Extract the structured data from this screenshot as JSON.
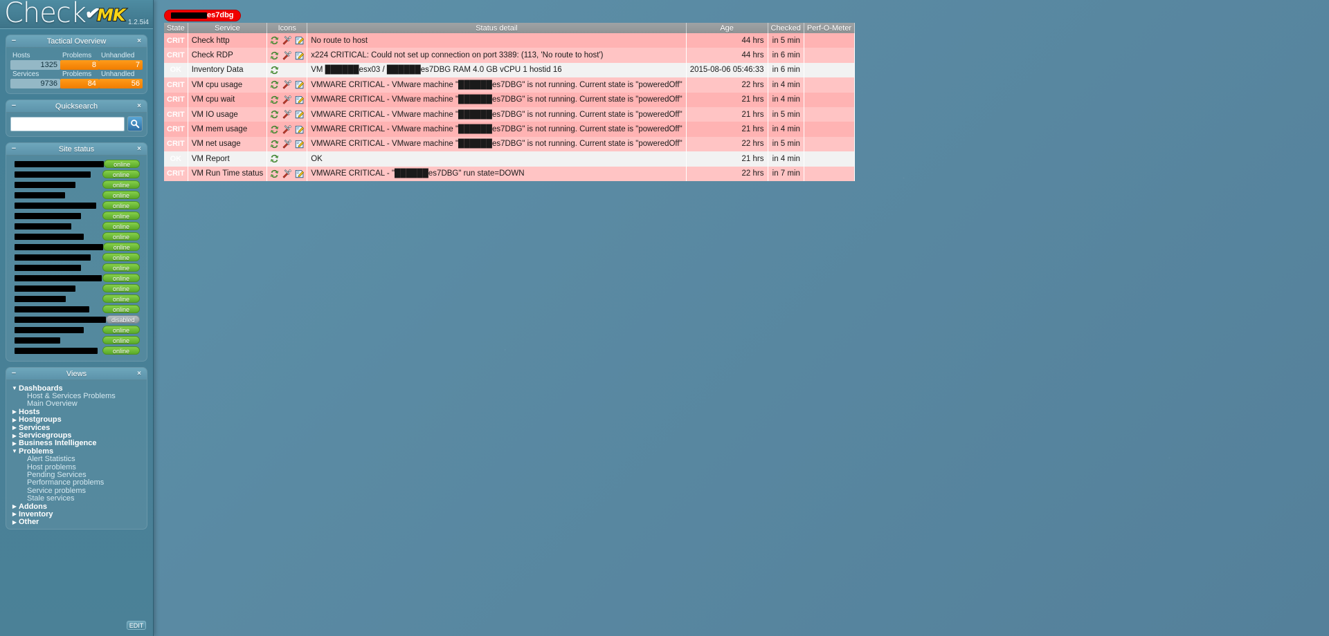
{
  "sidebar": {
    "logo": {
      "text": "Check",
      "mk": "MK",
      "check_glyph": "✔",
      "version": "1.2.5i4"
    },
    "tactical": {
      "title": "Tactical Overview",
      "minus": "−",
      "close": "×",
      "col_headers": [
        "",
        "Problems",
        "Unhandled"
      ],
      "rows": [
        {
          "label": "Hosts",
          "total": "1325",
          "problems": "8",
          "unhandled": "7"
        },
        {
          "label": "Services",
          "total": "9736",
          "problems": "84",
          "unhandled": "56"
        }
      ]
    },
    "quicksearch": {
      "title": "Quicksearch",
      "minus": "−",
      "close": "×",
      "value": "",
      "placeholder": "",
      "search_icon": "search-icon"
    },
    "site_status": {
      "title": "Site status",
      "minus": "−",
      "close": "×",
      "sites": [
        {
          "name_width": 135,
          "status": "online",
          "label": "online"
        },
        {
          "name_width": 110,
          "status": "online",
          "label": "online"
        },
        {
          "name_width": 88,
          "status": "online",
          "label": "online"
        },
        {
          "name_width": 73,
          "status": "online",
          "label": "online"
        },
        {
          "name_width": 118,
          "status": "online",
          "label": "online"
        },
        {
          "name_width": 96,
          "status": "online",
          "label": "online"
        },
        {
          "name_width": 82,
          "status": "online",
          "label": "online"
        },
        {
          "name_width": 100,
          "status": "online",
          "label": "online"
        },
        {
          "name_width": 132,
          "status": "online",
          "label": "online"
        },
        {
          "name_width": 110,
          "status": "online",
          "label": "online"
        },
        {
          "name_width": 96,
          "status": "online",
          "label": "online"
        },
        {
          "name_width": 126,
          "status": "online",
          "label": "online"
        },
        {
          "name_width": 88,
          "status": "online",
          "label": "online"
        },
        {
          "name_width": 74,
          "status": "online",
          "label": "online"
        },
        {
          "name_width": 108,
          "status": "online",
          "label": "online"
        },
        {
          "name_width": 148,
          "status": "disabled",
          "label": "disabled"
        },
        {
          "name_width": 100,
          "status": "online",
          "label": "online"
        },
        {
          "name_width": 66,
          "status": "online",
          "label": "online"
        },
        {
          "name_width": 120,
          "status": "online",
          "label": "online"
        }
      ]
    },
    "views": {
      "title": "Views",
      "minus": "−",
      "close": "×",
      "edit_label": "EDIT",
      "items": [
        {
          "label": "Dashboards",
          "type": "top",
          "expanded": true
        },
        {
          "label": "Host & Services Problems",
          "type": "sub"
        },
        {
          "label": "Main Overview",
          "type": "sub"
        },
        {
          "label": "Hosts",
          "type": "top",
          "expanded": false
        },
        {
          "label": "Hostgroups",
          "type": "top",
          "expanded": false
        },
        {
          "label": "Services",
          "type": "top",
          "expanded": false
        },
        {
          "label": "Servicegroups",
          "type": "top",
          "expanded": false
        },
        {
          "label": "Business Intelligence",
          "type": "top",
          "expanded": false
        },
        {
          "label": "Problems",
          "type": "top",
          "expanded": true
        },
        {
          "label": "Alert Statistics",
          "type": "sub"
        },
        {
          "label": "Host problems",
          "type": "sub"
        },
        {
          "label": "Pending Services",
          "type": "sub"
        },
        {
          "label": "Performance problems",
          "type": "sub"
        },
        {
          "label": "Service problems",
          "type": "sub"
        },
        {
          "label": "Stale services",
          "type": "sub"
        },
        {
          "label": "Addons",
          "type": "top",
          "expanded": false
        },
        {
          "label": "Inventory",
          "type": "top",
          "expanded": false
        },
        {
          "label": "Other",
          "type": "top",
          "expanded": false
        }
      ]
    }
  },
  "main": {
    "host_badge": {
      "redacted_width": 52,
      "name": "es7dbg"
    },
    "table": {
      "columns": [
        "State",
        "Service",
        "Icons",
        "Status detail",
        "Age",
        "Checked",
        "Perf-O-Meter"
      ],
      "rows": [
        {
          "state": "CRIT",
          "service": "Check http",
          "icons": [
            "reschedule-icon",
            "wrench-icon",
            "notes-icon"
          ],
          "detail": "No route to host",
          "age": "44 hrs",
          "checked": "in 5 min",
          "perf": ""
        },
        {
          "state": "CRIT",
          "service": "Check RDP",
          "icons": [
            "reschedule-icon",
            "wrench-icon",
            "notes-icon"
          ],
          "detail": "x224 CRITICAL: Could not set up connection on port 3389: (113, 'No route to host')",
          "age": "44 hrs",
          "checked": "in 6 min",
          "perf": ""
        },
        {
          "state": "OK",
          "service": "Inventory Data",
          "icons": [
            "reschedule-icon"
          ],
          "detail": "VM ██████esx03 / ██████es7DBG RAM 4.0 GB vCPU 1 hostid 16",
          "age": "2015-08-06 05:46:33",
          "checked": "in 6 min",
          "perf": ""
        },
        {
          "state": "CRIT",
          "service": "VM cpu usage",
          "icons": [
            "reschedule-icon",
            "wrench-icon",
            "notes-icon"
          ],
          "detail": "VMWARE CRITICAL - VMware machine \"██████es7DBG\" is not running. Current state is \"poweredOff\"",
          "age": "22 hrs",
          "checked": "in 4 min",
          "perf": ""
        },
        {
          "state": "CRIT",
          "service": "VM cpu wait",
          "icons": [
            "reschedule-icon",
            "wrench-icon",
            "notes-icon"
          ],
          "detail": "VMWARE CRITICAL - VMware machine \"██████es7DBG\" is not running. Current state is \"poweredOff\"",
          "age": "21 hrs",
          "checked": "in 4 min",
          "perf": ""
        },
        {
          "state": "CRIT",
          "service": "VM IO usage",
          "icons": [
            "reschedule-icon",
            "wrench-icon",
            "notes-icon"
          ],
          "detail": "VMWARE CRITICAL - VMware machine \"██████es7DBG\" is not running. Current state is \"poweredOff\"",
          "age": "21 hrs",
          "checked": "in 5 min",
          "perf": ""
        },
        {
          "state": "CRIT",
          "service": "VM mem usage",
          "icons": [
            "reschedule-icon",
            "wrench-icon",
            "notes-icon"
          ],
          "detail": "VMWARE CRITICAL - VMware machine \"██████es7DBG\" is not running. Current state is \"poweredOff\"",
          "age": "21 hrs",
          "checked": "in 4 min",
          "perf": ""
        },
        {
          "state": "CRIT",
          "service": "VM net usage",
          "icons": [
            "reschedule-icon",
            "wrench-icon",
            "notes-icon"
          ],
          "detail": "VMWARE CRITICAL - VMware machine \"██████es7DBG\" is not running. Current state is \"poweredOff\"",
          "age": "22 hrs",
          "checked": "in 5 min",
          "perf": ""
        },
        {
          "state": "OK",
          "service": "VM Report",
          "icons": [
            "reschedule-icon"
          ],
          "detail": "OK",
          "age": "21 hrs",
          "checked": "in 4 min",
          "perf": ""
        },
        {
          "state": "CRIT",
          "service": "VM Run Time status",
          "icons": [
            "reschedule-icon",
            "wrench-icon",
            "notes-icon"
          ],
          "detail": "VMWARE CRITICAL - \"██████es7DBG\" run state=DOWN",
          "age": "22 hrs",
          "checked": "in 7 min",
          "perf": ""
        }
      ]
    }
  },
  "colors": {
    "crit": "#ff0000",
    "ok": "#13c313",
    "crit_row": "#ffb3b3",
    "orange": "#f07c00",
    "online": "#5aa929",
    "disabled": "#8c989d",
    "background": "#5b8ca5"
  }
}
